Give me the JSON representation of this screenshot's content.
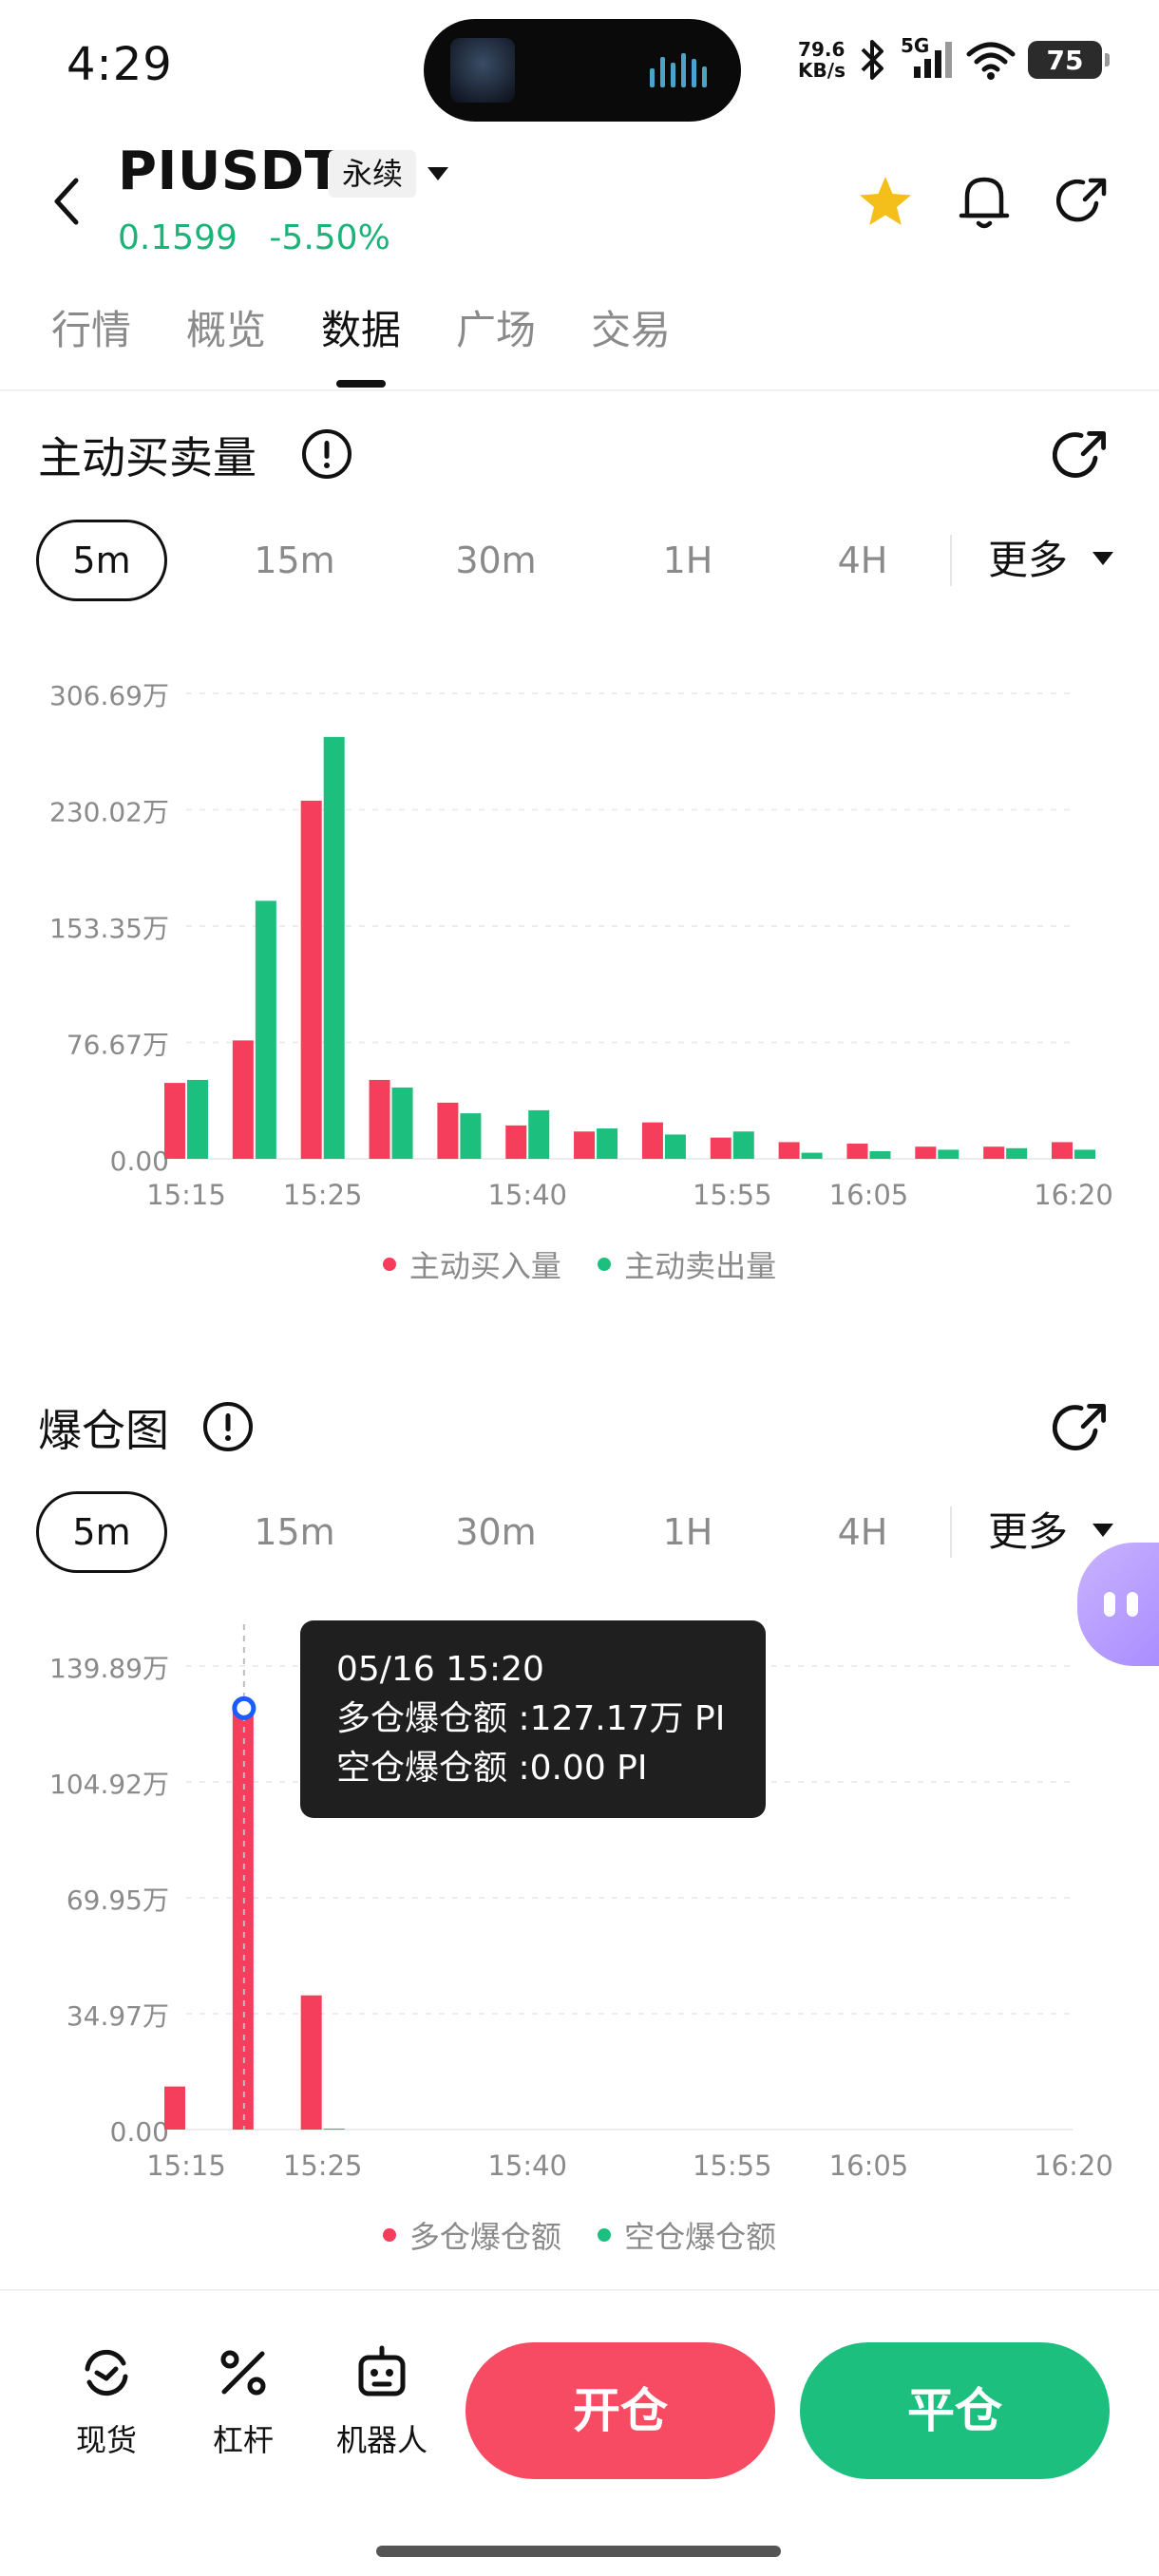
{
  "status_bar": {
    "time": "4:29",
    "net_speed_value": "79.6",
    "net_speed_unit": "KB/s",
    "network": "5G",
    "battery": "75"
  },
  "header": {
    "symbol": "PIUSDT",
    "contract_type": "永续",
    "price": "0.1599",
    "change": "-5.50%",
    "favorite_color": "#f5bf1b"
  },
  "tabs": [
    "行情",
    "概览",
    "数据",
    "广场",
    "交易"
  ],
  "active_tab": "数据",
  "intervals": [
    "5m",
    "15m",
    "30m",
    "1H",
    "4H"
  ],
  "more_label": "更多",
  "taker_section": {
    "title": "主动买卖量",
    "active_interval": "5m",
    "legend": [
      {
        "name": "主动买入量",
        "color": "#f53d5c"
      },
      {
        "name": "主动卖出量",
        "color": "#1cbf7e"
      }
    ]
  },
  "liq_section": {
    "title": "爆仓图",
    "active_interval": "5m",
    "legend": [
      {
        "name": "多仓爆仓额",
        "color": "#f53d5c"
      },
      {
        "name": "空仓爆仓额",
        "color": "#1cbf7e"
      }
    ],
    "tooltip": {
      "time": "05/16 15:20",
      "long_line": "多仓爆仓额 :127.17万 PI",
      "short_line": "空仓爆仓额 :0.00 PI"
    }
  },
  "bottom_bar": {
    "spot": "现货",
    "leverage": "杠杆",
    "bot": "机器人",
    "open": "开仓",
    "close": "平仓"
  },
  "chart_data": [
    {
      "type": "bar",
      "title": "主动买卖量",
      "x_ticks": [
        "15:15",
        "15:25",
        "15:40",
        "15:55",
        "16:05",
        "16:20"
      ],
      "y_ticks": [
        "0.00",
        "76.67万",
        "153.35万",
        "230.02万",
        "306.69万"
      ],
      "ylim": [
        0,
        306.69
      ],
      "categories": [
        "15:15",
        "15:20",
        "15:25",
        "15:30",
        "15:35",
        "15:40",
        "15:45",
        "15:50",
        "15:55",
        "16:00",
        "16:05",
        "16:10",
        "16:15",
        "16:20"
      ],
      "series": [
        {
          "name": "主动买入量",
          "color": "#f53d5c",
          "values": [
            50,
            78,
            236,
            52,
            37,
            22,
            18,
            24,
            14,
            11,
            10,
            8,
            8,
            11
          ]
        },
        {
          "name": "主动卖出量",
          "color": "#1cbf7e",
          "values": [
            52,
            170,
            278,
            47,
            30,
            32,
            20,
            16,
            18,
            4,
            5,
            6,
            7,
            6
          ]
        }
      ],
      "grid": true,
      "legend_position": "bottom"
    },
    {
      "type": "bar",
      "title": "爆仓图",
      "x_ticks": [
        "15:15",
        "15:25",
        "15:40",
        "15:55",
        "16:05",
        "16:20"
      ],
      "y_ticks": [
        "0.00",
        "34.97万",
        "69.95万",
        "104.92万",
        "139.89万"
      ],
      "ylim": [
        0,
        139.89
      ],
      "categories": [
        "15:15",
        "15:20",
        "15:25"
      ],
      "series": [
        {
          "name": "多仓爆仓额",
          "color": "#f53d5c",
          "values": [
            13,
            127.17,
            40.5
          ]
        },
        {
          "name": "空仓爆仓额",
          "color": "#1cbf7e",
          "values": [
            0,
            0,
            0.3
          ]
        }
      ],
      "grid": true,
      "legend_position": "bottom",
      "highlighted_category": "15:20"
    }
  ]
}
